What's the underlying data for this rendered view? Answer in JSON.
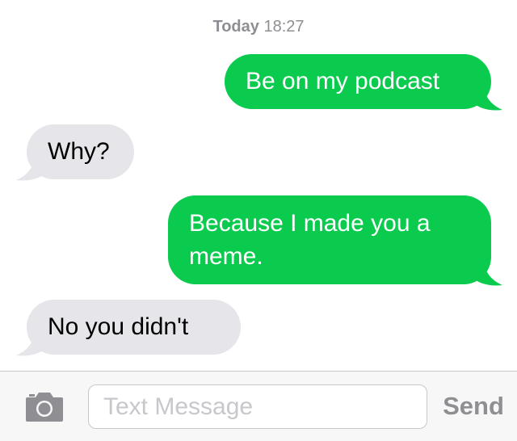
{
  "conversation": {
    "timestamp": {
      "day": "Today",
      "time": "18:27"
    },
    "messages": [
      {
        "direction": "outgoing",
        "text": "Be on my podcast"
      },
      {
        "direction": "incoming",
        "text": "Why?"
      },
      {
        "direction": "outgoing",
        "text": "Because I made you a meme."
      },
      {
        "direction": "incoming",
        "text": "No you didn't"
      }
    ]
  },
  "composer": {
    "camera_icon": "camera-icon",
    "input_value": "",
    "placeholder": "Text Message",
    "send_label": "Send"
  },
  "colors": {
    "outgoing_bubble": "#0acb4e",
    "incoming_bubble": "#e5e5ea",
    "muted_text": "#8e8e93"
  }
}
